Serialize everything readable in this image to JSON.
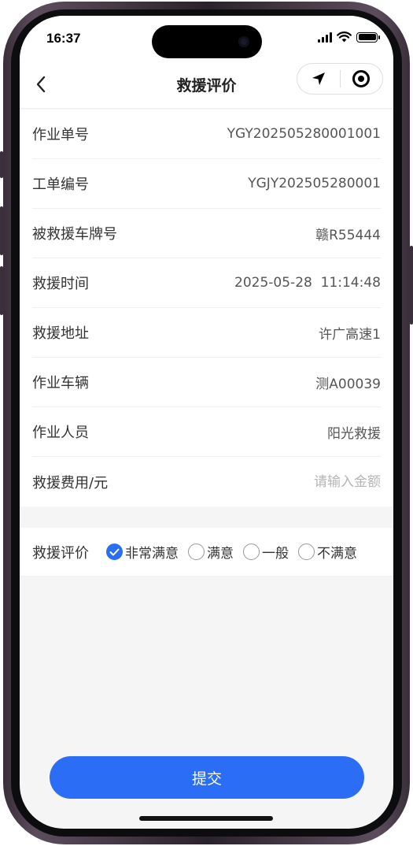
{
  "status_bar": {
    "time": "16:37",
    "battery_level": 1.0
  },
  "nav": {
    "title": "救援评价",
    "back_icon": "chevron-left-icon",
    "location_icon": "location-arrow-icon",
    "target_icon": "target-icon"
  },
  "form": {
    "rows": [
      {
        "label": "作业单号",
        "value": "YGY202505280001001"
      },
      {
        "label": "工单编号",
        "value": "YGJY202505280001"
      },
      {
        "label": "被救援车牌号",
        "value": "赣R55444"
      },
      {
        "label": "救援时间",
        "value": "2025-05-28  11:14:48"
      },
      {
        "label": "救援地址",
        "value": "许广高速1"
      },
      {
        "label": "作业车辆",
        "value": "测A00039"
      },
      {
        "label": "作业人员",
        "value": "阳光救援"
      }
    ],
    "fee": {
      "label": "救援费用/元",
      "value": "",
      "placeholder": "请输入金额"
    }
  },
  "rating": {
    "label": "救援评价",
    "options": [
      {
        "label": "非常满意",
        "checked": true
      },
      {
        "label": "满意",
        "checked": false
      },
      {
        "label": "一般",
        "checked": false
      },
      {
        "label": "不满意",
        "checked": false
      }
    ]
  },
  "submit": {
    "label": "提交"
  },
  "colors": {
    "accent": "#2b6ef5",
    "page_bg": "#f5f5f5"
  }
}
